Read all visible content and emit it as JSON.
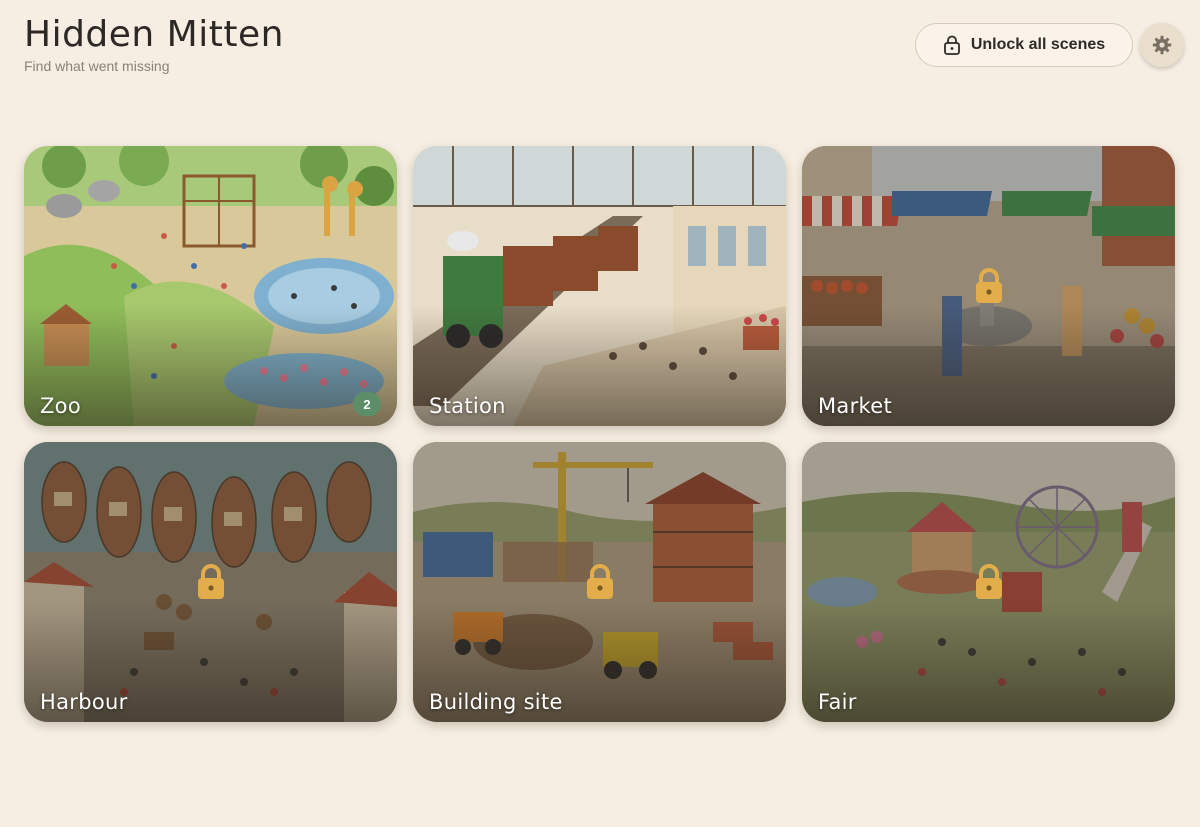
{
  "header": {
    "title": "Hidden Mitten",
    "subtitle": "Find what went missing"
  },
  "toolbar": {
    "unlock_label": "Unlock all scenes",
    "unlock_icon": "lock-icon",
    "settings_icon": "gear-icon"
  },
  "colors": {
    "background": "#f6eee2",
    "badge": "#5c8e67",
    "lock": "#e2ad4a"
  },
  "scenes": [
    {
      "name": "Zoo",
      "locked": false,
      "badge": "2"
    },
    {
      "name": "Station",
      "locked": false
    },
    {
      "name": "Market",
      "locked": true
    },
    {
      "name": "Harbour",
      "locked": true
    },
    {
      "name": "Building site",
      "locked": true
    },
    {
      "name": "Fair",
      "locked": true
    }
  ]
}
